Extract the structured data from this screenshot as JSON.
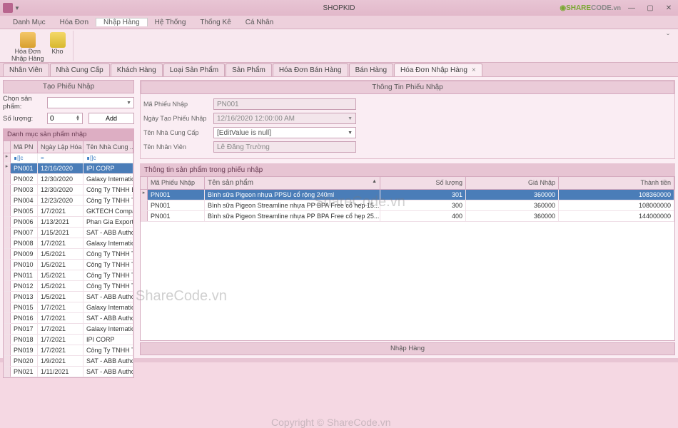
{
  "window": {
    "title": "SHOPKID"
  },
  "logo": {
    "p1": "SHARE",
    "p2": "CODE",
    "suffix": ".vn"
  },
  "menu": [
    "Danh Mục",
    "Hóa Đơn",
    "Nhập Hàng",
    "Hệ Thống",
    "Thống Kê",
    "Cá Nhân"
  ],
  "ribbon": {
    "items": [
      {
        "label": "Hóa Đơn\nNhập Hàng"
      },
      {
        "label": "Kho"
      }
    ]
  },
  "tabs": [
    "Nhân Viên",
    "Nhà Cung Cấp",
    "Khách Hàng",
    "Loại Sản Phẩm",
    "Sản Phẩm",
    "Hóa Đơn Bán Hàng",
    "Bán Hàng",
    "Hóa Đơn Nhập Hàng"
  ],
  "left": {
    "create_header": "Tạo Phiếu Nhập",
    "product_label": "Chọn sản phẩm:",
    "qty_label": "Số lượng:",
    "qty_value": "0",
    "add_btn": "Add",
    "list_header": "Danh mục sản phẩm nhập",
    "cols": [
      "Mã PN",
      "Ngày Lập Hóa ...",
      "Tên Nhà Cung ..."
    ],
    "filter_ops": [
      "∎[]c",
      "=",
      "∎[]c"
    ],
    "rows": [
      [
        "PN001",
        "12/16/2020",
        "IPI CORP"
      ],
      [
        "PN002",
        "12/30/2020",
        "Galaxy Internatio..."
      ],
      [
        "PN003",
        "12/30/2020",
        "Công Ty TNHH B..."
      ],
      [
        "PN004",
        "12/23/2020",
        "Công Ty TNHH T..."
      ],
      [
        "PN005",
        "1/7/2021",
        "GKTECH Company"
      ],
      [
        "PN006",
        "1/13/2021",
        "Phan Gia Export ..."
      ],
      [
        "PN007",
        "1/15/2021",
        "SAT - ABB Autho..."
      ],
      [
        "PN008",
        "1/7/2021",
        "Galaxy Internatio..."
      ],
      [
        "PN009",
        "1/5/2021",
        "Công Ty TNHH T..."
      ],
      [
        "PN010",
        "1/5/2021",
        "Công Ty TNHH T..."
      ],
      [
        "PN011",
        "1/5/2021",
        "Công Ty TNHH T..."
      ],
      [
        "PN012",
        "1/5/2021",
        "Công Ty TNHH T..."
      ],
      [
        "PN013",
        "1/5/2021",
        "SAT - ABB Autho..."
      ],
      [
        "PN015",
        "1/7/2021",
        "Galaxy Internatio..."
      ],
      [
        "PN016",
        "1/7/2021",
        "SAT - ABB Autho..."
      ],
      [
        "PN017",
        "1/7/2021",
        "Galaxy Internatio..."
      ],
      [
        "PN018",
        "1/7/2021",
        "IPI CORP"
      ],
      [
        "PN019",
        "1/7/2021",
        "Công Ty TNHH T..."
      ],
      [
        "PN020",
        "1/9/2021",
        "SAT - ABB Autho..."
      ],
      [
        "PN021",
        "1/11/2021",
        "SAT - ABB Autho..."
      ]
    ]
  },
  "detail": {
    "header": "Thông Tin Phiếu Nhập",
    "fields": {
      "ma_label": "Mã Phiếu Nhập",
      "ma_val": "PN001",
      "ngay_label": "Ngày Tạo Phiếu Nhập",
      "ngay_val": "12/16/2020 12:00:00 AM",
      "ncc_label": "Tên Nhà Cung Cấp",
      "ncc_val": "[EditValue is null]",
      "nv_label": "Tên Nhân Viên",
      "nv_val": "Lê Đăng Trường"
    }
  },
  "detail_grid": {
    "header": "Thông tin sản phẩm trong phiếu nhập",
    "cols": [
      "Mã Phiếu Nhập",
      "Tên sản phẩm",
      "Số lượng",
      "Giá Nhập",
      "Thành tiền"
    ],
    "rows": [
      [
        "PN001",
        "Bình sữa Pigeon nhựa PPSU cổ rộng 240ml",
        "301",
        "360000",
        "108360000"
      ],
      [
        "PN001",
        "Bình sữa Pigeon Streamline nhựa PP BPA Free cổ hẹp 15...",
        "300",
        "360000",
        "108000000"
      ],
      [
        "PN001",
        "Bình sữa Pigeon Streamline nhựa PP BPA Free cổ hẹp 25...",
        "400",
        "360000",
        "144000000"
      ]
    ]
  },
  "bottom_btn": "Nhập Hàng",
  "watermarks": {
    "w1": "ShareCode.vn",
    "w2": "ShareCode.vn",
    "w3": "Copyright © ShareCode.vn"
  }
}
